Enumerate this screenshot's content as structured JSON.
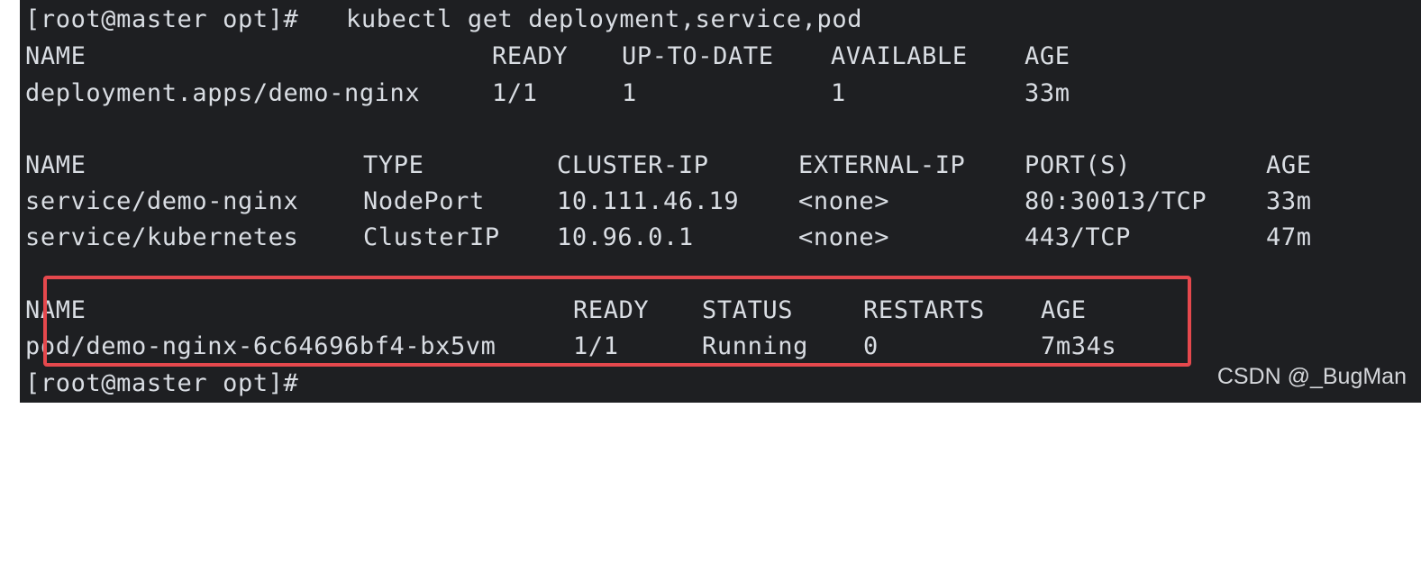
{
  "terminal": {
    "command": {
      "prompt": "[root@master opt]#",
      "text": "kubectl get deployment,service,pod"
    },
    "deployment_table": {
      "headers": [
        "NAME",
        "READY",
        "UP-TO-DATE",
        "AVAILABLE",
        "AGE"
      ],
      "rows": [
        [
          "deployment.apps/demo-nginx",
          "1/1",
          "1",
          "1",
          "33m"
        ]
      ]
    },
    "service_table": {
      "headers": [
        "NAME",
        "TYPE",
        "CLUSTER-IP",
        "EXTERNAL-IP",
        "PORT(S)",
        "AGE"
      ],
      "rows": [
        [
          "service/demo-nginx",
          "NodePort",
          "10.111.46.19",
          "<none>",
          "80:30013/TCP",
          "33m"
        ],
        [
          "service/kubernetes",
          "ClusterIP",
          "10.96.0.1",
          "<none>",
          "443/TCP",
          "47m"
        ]
      ]
    },
    "pod_table": {
      "headers": [
        "NAME",
        "READY",
        "STATUS",
        "RESTARTS",
        "AGE"
      ],
      "rows": [
        [
          "pod/demo-nginx-6c64696bf4-bx5vm",
          "1/1",
          "Running",
          "0",
          "7m34s"
        ]
      ]
    },
    "final_prompt": "[root@master opt]#"
  },
  "watermark": "CSDN @_BugMan",
  "colors": {
    "background": "#1e1f22",
    "text": "#d9dde3",
    "highlight": "#e5484d"
  }
}
